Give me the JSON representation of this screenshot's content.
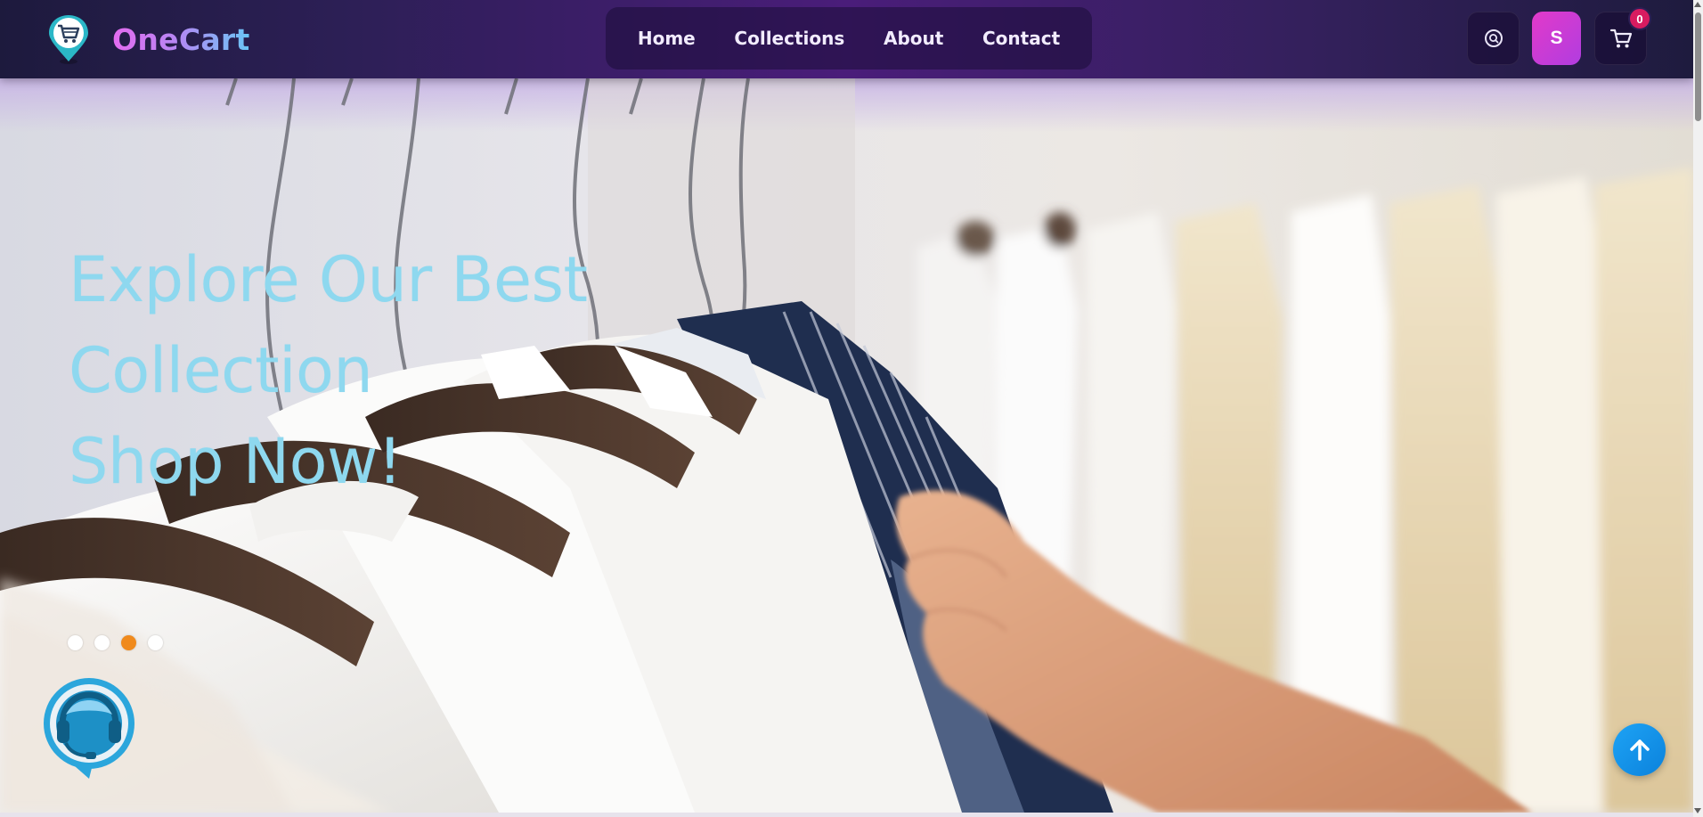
{
  "brand": {
    "name": "OneCart",
    "logo_icon": "location-pin-cart-icon"
  },
  "nav": {
    "links": [
      {
        "label": "Home"
      },
      {
        "label": "Collections"
      },
      {
        "label": "About"
      },
      {
        "label": "Contact"
      }
    ]
  },
  "header_actions": {
    "search_icon": "search-icon",
    "profile_initial": "S",
    "cart_icon": "cart-icon",
    "cart_count": "0"
  },
  "hero": {
    "heading_lines": [
      "Explore Our Best",
      "Collection",
      "Shop Now!"
    ],
    "slides_count": 4,
    "active_slide": 3,
    "heading_color": "#8ed8ef"
  },
  "floating": {
    "support_icon": "headset-support-icon",
    "scroll_top_icon": "arrow-up-icon"
  },
  "colors": {
    "accent_pink": "#e23ac9",
    "active_dot": "#f08a1c",
    "scroll_top": "#1ea3f5",
    "badge": "#d81b60"
  }
}
